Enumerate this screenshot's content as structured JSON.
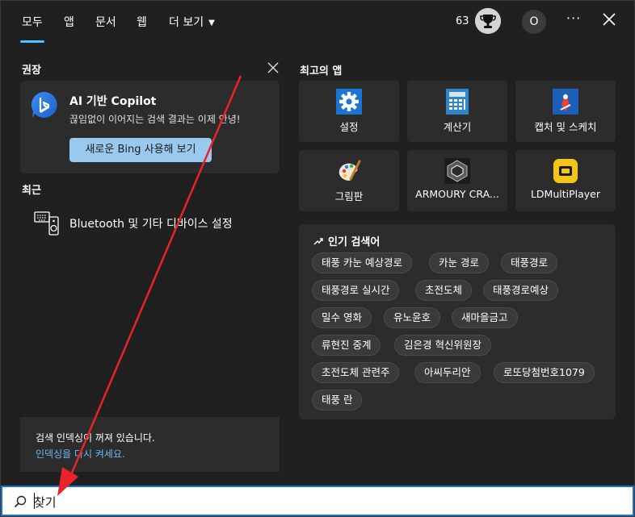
{
  "nav": {
    "tabs": [
      {
        "label": "모두",
        "active": true
      },
      {
        "label": "앱"
      },
      {
        "label": "문서"
      },
      {
        "label": "웹"
      },
      {
        "label": "더 보기"
      }
    ],
    "points": "63",
    "avatar_initial": "O",
    "more_label": "···"
  },
  "recommended": {
    "title": "권장",
    "copilot": {
      "title": "AI 기반 Copilot",
      "description": "끊임없이 이어지는 검색 결과는 이제 안녕!",
      "button_label": "새로운 Bing 사용해 보기"
    }
  },
  "recent": {
    "title": "최근",
    "items": [
      {
        "label": "Bluetooth 및 기타 디바이스 설정",
        "icon": "keyboard-speaker-icon"
      }
    ]
  },
  "index_banner": {
    "message": "검색 인덱싱이 꺼져 있습니다.",
    "link": "인덱싱을 다시 켜세요."
  },
  "top_apps": {
    "title": "최고의 앱",
    "apps": [
      {
        "label": "설정",
        "icon": "settings-gear-icon"
      },
      {
        "label": "계산기",
        "icon": "calculator-icon"
      },
      {
        "label": "캡처 및 스케치",
        "icon": "snip-sketch-icon"
      },
      {
        "label": "그림판",
        "icon": "paint-palette-icon"
      },
      {
        "label": "ARMOURY CRA...",
        "icon": "armoury-crate-icon"
      },
      {
        "label": "LDMultiPlayer",
        "icon": "ldmultiplayer-icon"
      }
    ]
  },
  "trending": {
    "title": "인기 검색어",
    "chips": [
      "태풍 카눈 예상경로",
      "카눈 경로",
      "태풍경로",
      "태풍경로 실시간",
      "초전도체",
      "태풍경로예상",
      "밀수 영화",
      "유노윤호",
      "새마을금고",
      "류현진 중계",
      "김은경 혁신위원장",
      "초전도체 관련주",
      "아씨두리안",
      "로또당첨번호1079",
      "태풍 란"
    ]
  },
  "search": {
    "value": "찾기"
  },
  "colors": {
    "accent": "#4cc2ff",
    "button": "#99c9ee",
    "link": "#6cb8f6",
    "annotation": "#e8232a"
  }
}
